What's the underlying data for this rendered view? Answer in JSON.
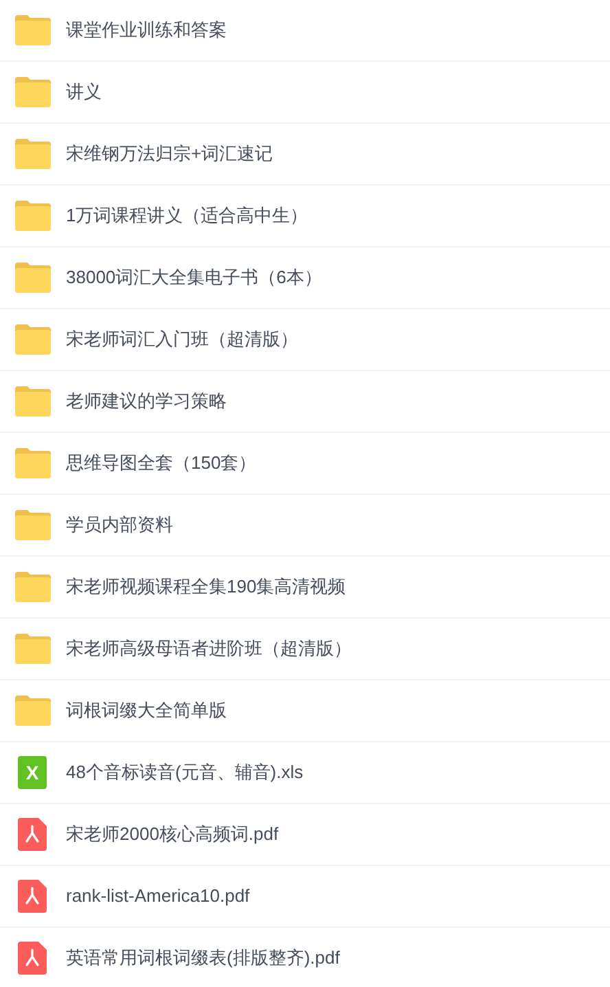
{
  "files": [
    {
      "kind": "folder",
      "name": "课堂作业训练和答案"
    },
    {
      "kind": "folder",
      "name": "讲义"
    },
    {
      "kind": "folder",
      "name": "宋维钢万法归宗+词汇速记"
    },
    {
      "kind": "folder",
      "name": "1万词课程讲义（适合高中生）"
    },
    {
      "kind": "folder",
      "name": "38000词汇大全集电子书（6本）"
    },
    {
      "kind": "folder",
      "name": "宋老师词汇入门班（超清版）"
    },
    {
      "kind": "folder",
      "name": "老师建议的学习策略"
    },
    {
      "kind": "folder",
      "name": "思维导图全套（150套）"
    },
    {
      "kind": "folder",
      "name": "学员内部资料"
    },
    {
      "kind": "folder",
      "name": "宋老师视频课程全集190集高清视频"
    },
    {
      "kind": "folder",
      "name": "宋老师高级母语者进阶班（超清版）"
    },
    {
      "kind": "folder",
      "name": "词根词缀大全简单版"
    },
    {
      "kind": "xls",
      "name": "48个音标读音(元音、辅音).xls",
      "badge": "X"
    },
    {
      "kind": "pdf",
      "name": "宋老师2000核心高频词.pdf"
    },
    {
      "kind": "pdf",
      "name": "rank-list-America10.pdf"
    },
    {
      "kind": "pdf",
      "name": "英语常用词根词缀表(排版整齐).pdf"
    }
  ]
}
